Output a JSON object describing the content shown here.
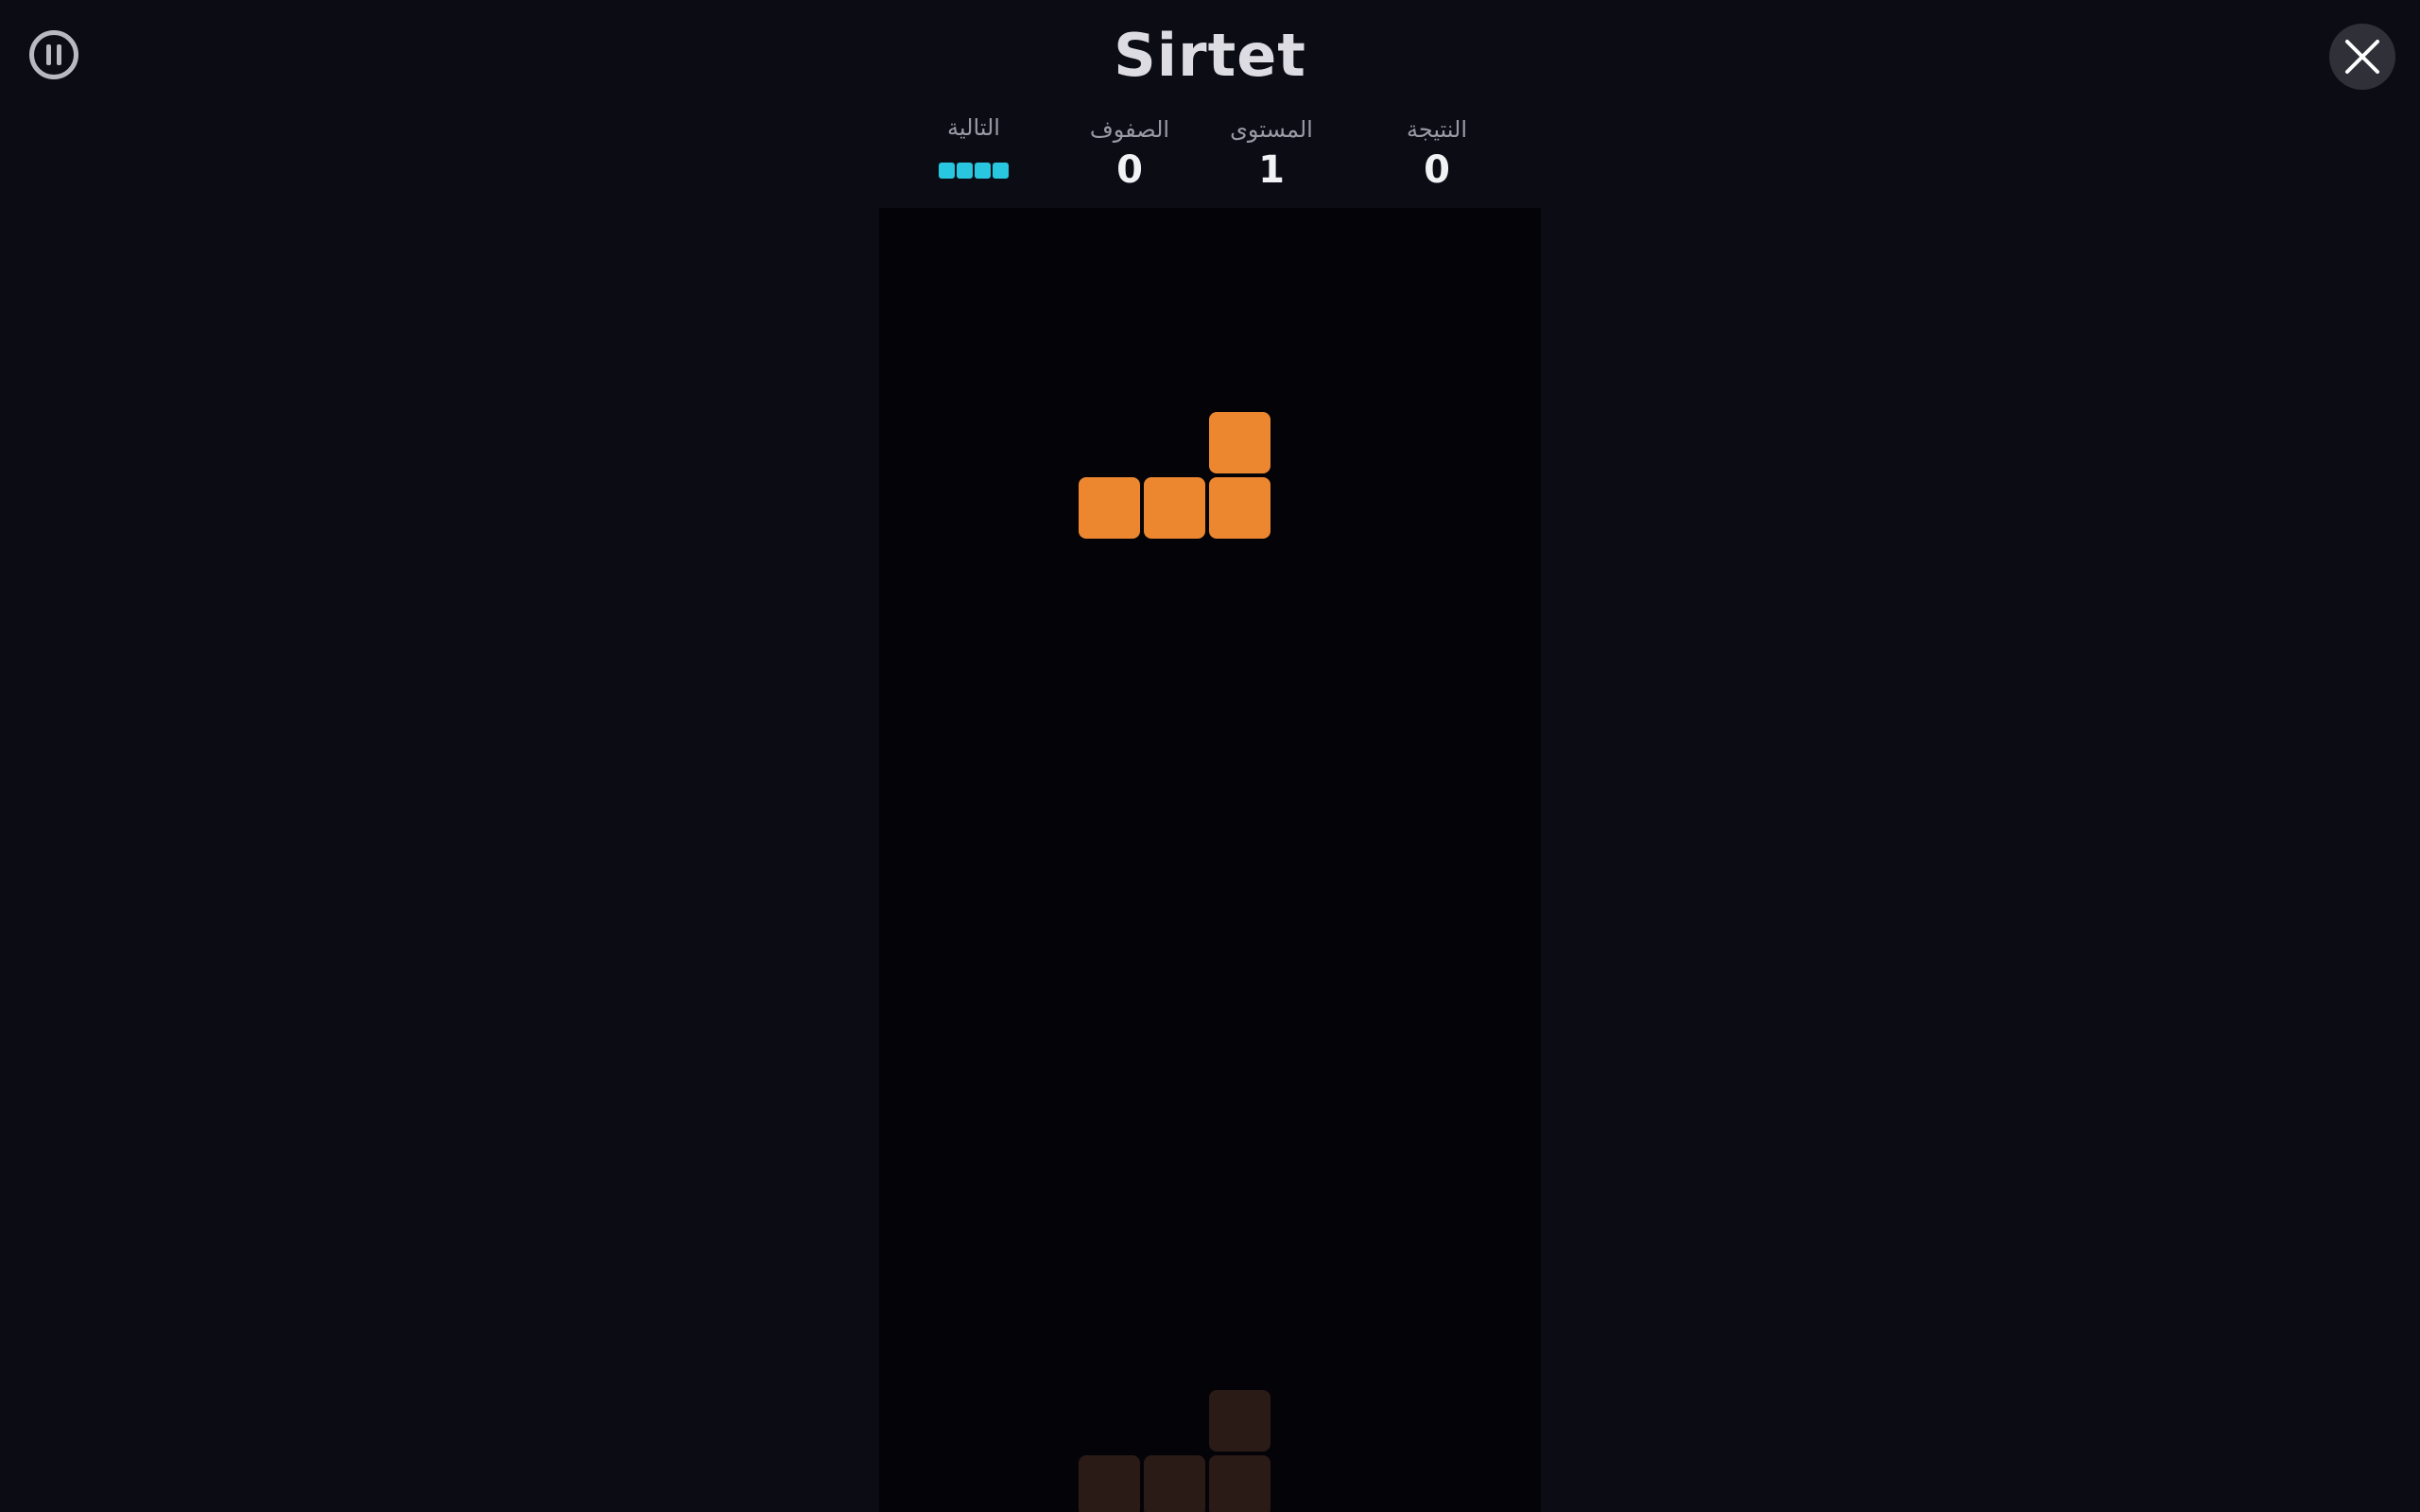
{
  "game": {
    "title": "Sirtet"
  },
  "stats": {
    "next_label": "التالية",
    "lines_label": "الصفوف",
    "lines_value": "0",
    "level_label": "المستوى",
    "level_value": "1",
    "score_label": "النتيجة",
    "score_value": "0"
  },
  "colors": {
    "background": "#0b0c14",
    "board": "#040408",
    "active_piece": "#ec8730",
    "ghost_piece": "#2a1b17",
    "next_piece": "#29c6df",
    "title": "#dcdce2"
  },
  "icons": {
    "pause": "pause-icon",
    "close": "close-icon"
  },
  "board": {
    "columns": 10,
    "next_piece": "I",
    "active_piece": {
      "shape": "L",
      "cells": [
        [
          5,
          3
        ],
        [
          3,
          4
        ],
        [
          4,
          4
        ],
        [
          5,
          4
        ]
      ]
    },
    "ghost_piece": {
      "shape": "L",
      "cells": [
        [
          5,
          18
        ],
        [
          3,
          19
        ],
        [
          4,
          19
        ],
        [
          5,
          19
        ]
      ]
    }
  }
}
